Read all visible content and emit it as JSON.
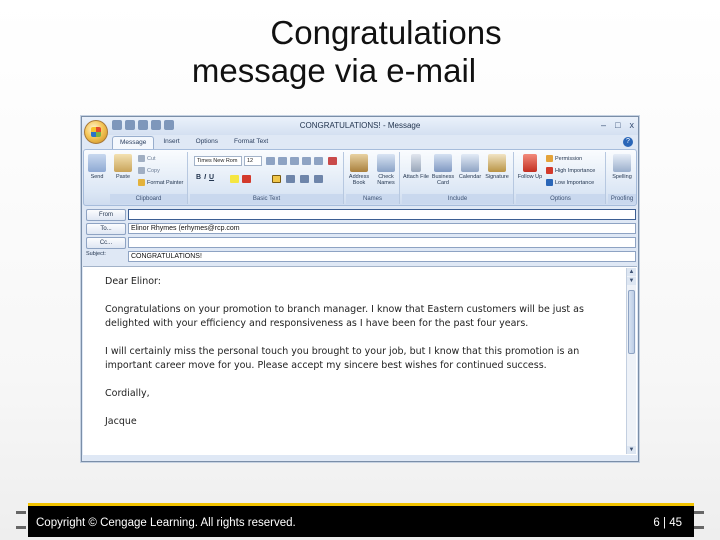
{
  "slide": {
    "title_line1": "Congratulations",
    "title_line2": "message via e-mail",
    "footer_text": "Copyright © Cengage Learning. All rights reserved.",
    "page_number": "6 | 45"
  },
  "window": {
    "title": "CONGRATULATIONS! - Message",
    "controls": [
      "–",
      "□",
      "x"
    ],
    "help": "?"
  },
  "tabs": [
    "Message",
    "Insert",
    "Options",
    "Format Text"
  ],
  "ribbon": {
    "send": "Send",
    "paste": "Paste",
    "cut": "Cut",
    "copy": "Copy",
    "format_painter": "Format Painter",
    "font_name": "Times New Rom",
    "font_size": "12",
    "bold": "B",
    "italic": "I",
    "underline": "U",
    "address_book": "Address Book",
    "check_names": "Check Names",
    "attach_file": "Attach File",
    "business_card": "Business Card",
    "calendar": "Calendar",
    "signature": "Signature",
    "follow_up": "Follow Up",
    "permission": "Permission",
    "high_importance": "High Importance",
    "low_importance": "Low Importance",
    "spelling": "Spelling",
    "groups": {
      "clipboard": "Clipboard",
      "basic_text": "Basic Text",
      "names": "Names",
      "include": "Include",
      "options": "Options",
      "proofing": "Proofing"
    }
  },
  "header": {
    "from_label": "From",
    "to_label": "To...",
    "cc_label": "Cc...",
    "subject_label": "Subject:",
    "from_value": "",
    "to_value": "Elinor Rhymes (erhymes@rcp.com",
    "cc_value": "",
    "subject_value": "CONGRATULATIONS!"
  },
  "message": {
    "greeting": "Dear Elinor:",
    "para1": "Congratulations on your promotion to branch manager. I know that Eastern customers will be just as delighted with your efficiency and responsiveness as I have been for the past four years.",
    "para2": "I will certainly miss the personal touch you brought to your job, but I know that this promotion is an important career move for you. Please accept my sincere best wishes for continued success.",
    "closing": "Cordially,",
    "signature": "Jacque"
  },
  "colors": {
    "footer_bg": "#000000",
    "footer_accent": "#f2c300",
    "ribbon_blue": "#dce7f5"
  }
}
